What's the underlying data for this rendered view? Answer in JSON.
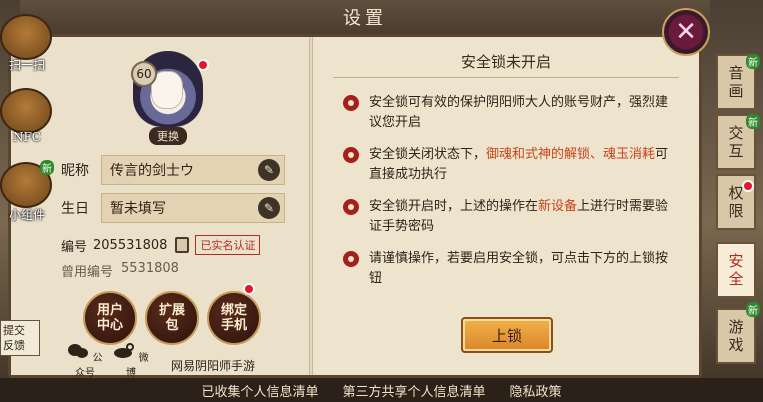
{
  "title": "设置",
  "profile": {
    "level": "60",
    "change_label": "更换",
    "nickname_label": "昵称",
    "nickname_value": "传言的剑士ウ",
    "birthday_label": "生日",
    "birthday_value": "暂未填写",
    "id_label": "编号",
    "id_value": "205531808",
    "verified_label": "已实名认证",
    "old_id_label": "曾用编号",
    "old_id_value": "5531808"
  },
  "actions": {
    "service_label": "用户中心",
    "service_line1": "用户",
    "service_line2": "中心",
    "ext_line1": "扩展",
    "ext_line2": "包",
    "bind_line1": "绑定",
    "bind_line2": "手机"
  },
  "social": {
    "wechat_label": "公众号",
    "weibo_label": "微博",
    "brand": "网易阴阳师手游"
  },
  "security": {
    "title": "安全锁未开启",
    "items": [
      {
        "text": "安全锁可有效的保护阴阳师大人的账号财产，强烈建议您开启"
      },
      {
        "pre": "安全锁关闭状态下，",
        "hl": "御魂和式神的解锁、魂玉消耗",
        "post": "可直接成功执行"
      },
      {
        "pre": "安全锁开启时，上述的操作在",
        "hl": "新设备",
        "post": "上进行时需要验证手势密码"
      },
      {
        "text": "请谨慎操作，若要启用安全锁，可点击下方的上锁按钮"
      }
    ],
    "lock_button": "上锁"
  },
  "side_icons": {
    "scan_label": "扫一扫",
    "nfc_label": "NFC",
    "widget_label": "小组件",
    "new_label": "新"
  },
  "feedback": {
    "line1": "提交",
    "line2": "反馈"
  },
  "tabs": [
    {
      "line1": "音",
      "line2": "画",
      "new": "新"
    },
    {
      "line1": "交",
      "line2": "互",
      "new": "新"
    },
    {
      "line1": "权",
      "line2": "限",
      "new": ""
    },
    {
      "line1": "安",
      "line2": "全",
      "new": ""
    },
    {
      "line1": "游",
      "line2": "戏",
      "new": "新"
    }
  ],
  "bottom_links": {
    "collected": "已收集个人信息清单",
    "third_party": "第三方共享个人信息清单",
    "privacy": "隐私政策"
  },
  "colors": {
    "accent_red": "#a4211b",
    "highlight": "#c7461a",
    "panel_bg": "#e9ddc5",
    "button_gold": "#f2b24b"
  }
}
